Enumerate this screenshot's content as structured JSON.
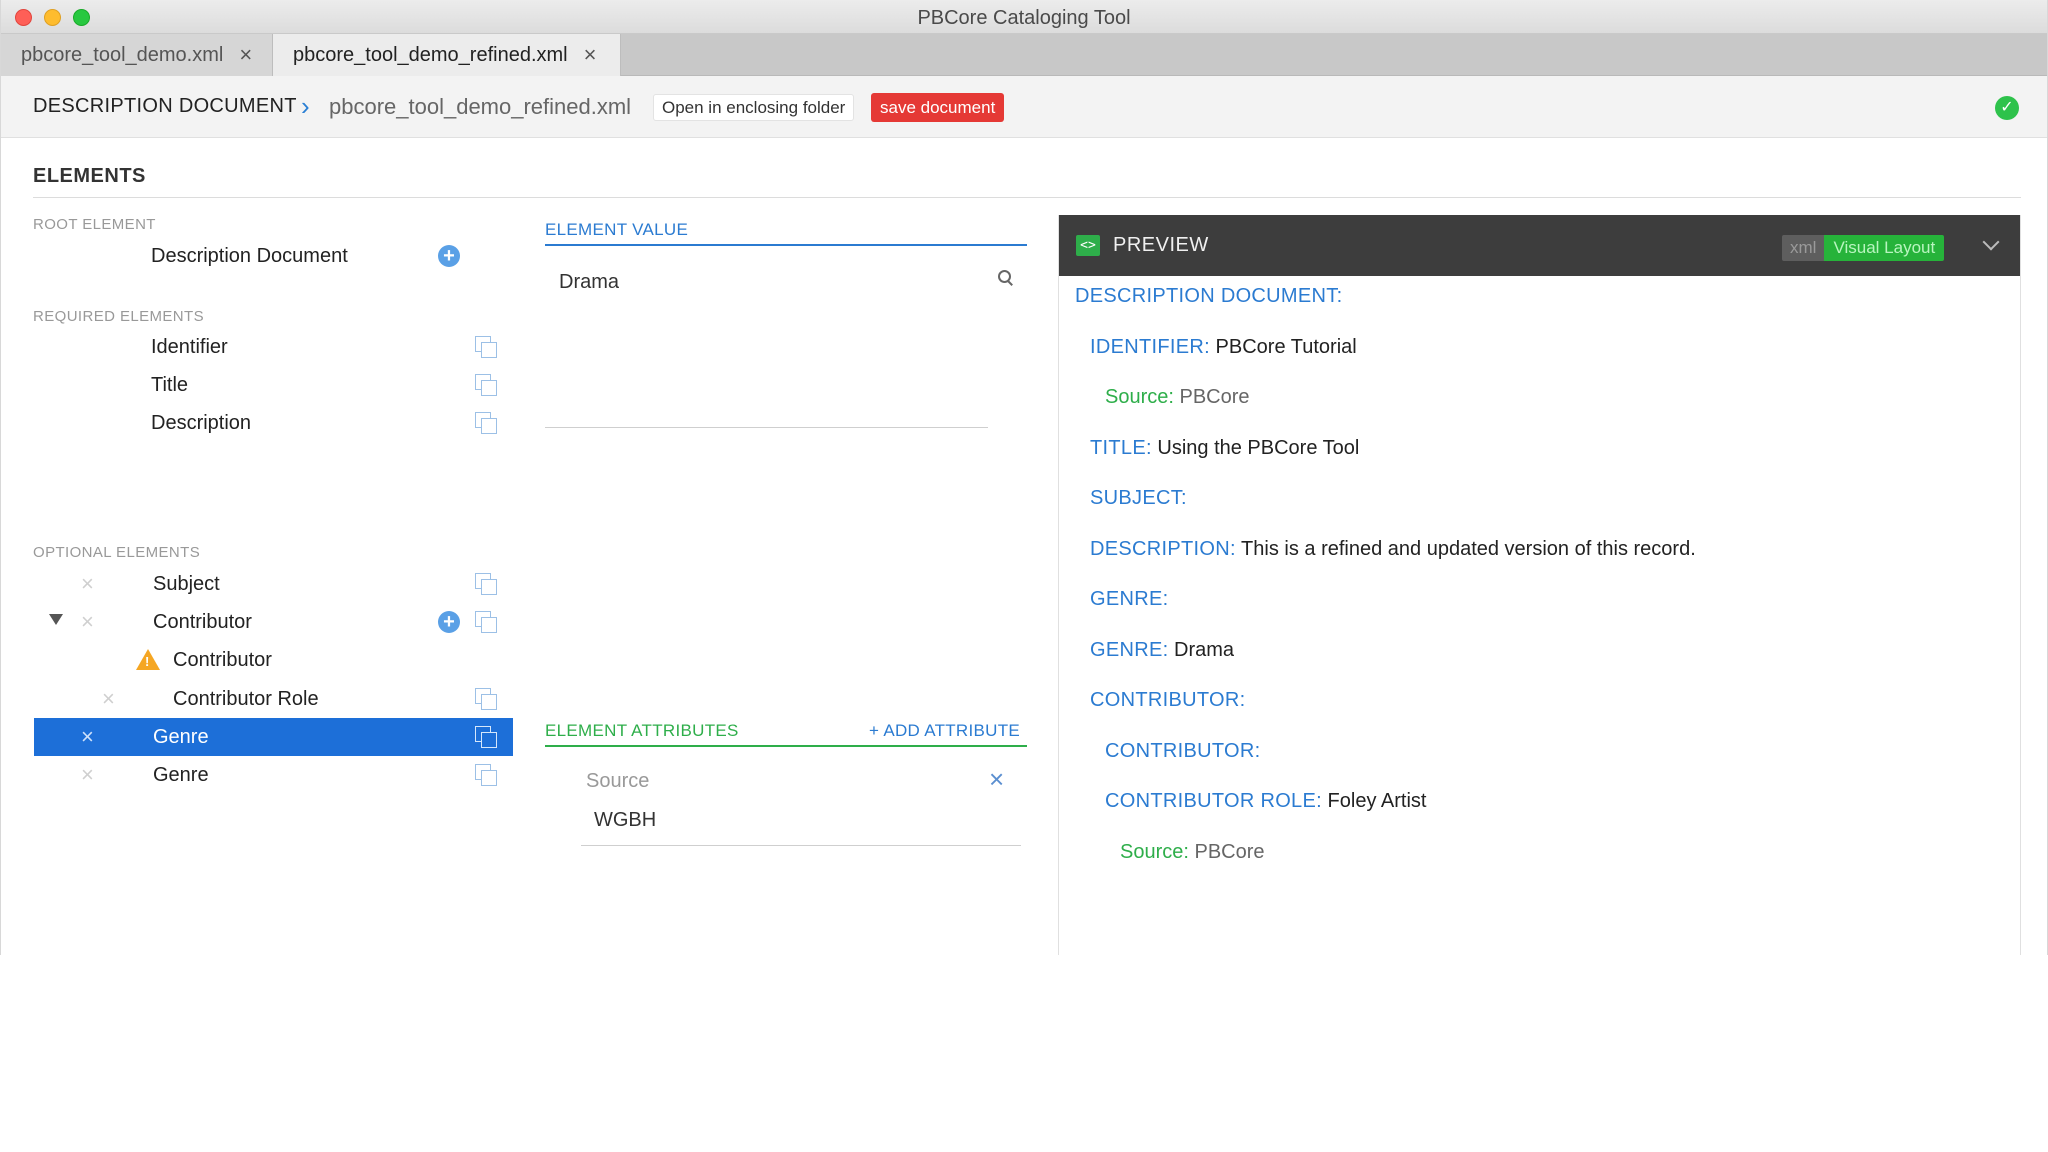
{
  "window": {
    "title": "PBCore Cataloging Tool"
  },
  "tabs": [
    {
      "label": "pbcore_tool_demo.xml",
      "close": "×"
    },
    {
      "label": "pbcore_tool_demo_refined.xml",
      "close": "×"
    }
  ],
  "breadcrumb": {
    "root": "DESCRIPTION DOCUMENT",
    "separator": "›",
    "file": "pbcore_tool_demo_refined.xml",
    "open_folder": "Open in enclosing folder",
    "save": "save document"
  },
  "elements": {
    "title": "ELEMENTS",
    "root_label": "ROOT ELEMENT",
    "root_item": "Description Document",
    "required_label": "REQUIRED ELEMENTS",
    "required": [
      "Identifier",
      "Title",
      "Description"
    ],
    "optional_label": "OPTIONAL ELEMENTS",
    "optional": [
      "Subject",
      "Contributor",
      "Contributor",
      "Contributor Role",
      "Genre",
      "Genre"
    ]
  },
  "element_value": {
    "label": "ELEMENT VALUE",
    "value": "Drama"
  },
  "attributes": {
    "label": "ELEMENT ATTRIBUTES",
    "add": "+ ADD ATTRIBUTE",
    "name": "Source",
    "value": "WGBH",
    "remove": "×"
  },
  "preview": {
    "title": "PREVIEW",
    "toggle_xml": "xml",
    "toggle_visual": "Visual Layout",
    "lines": [
      {
        "key": "DESCRIPTION DOCUMENT:",
        "value": ""
      },
      {
        "key": "IDENTIFIER:",
        "value": "PBCore Tutorial"
      },
      {
        "key": "Source:",
        "value": "PBCore"
      },
      {
        "key": "TITLE:",
        "value": "Using the PBCore Tool"
      },
      {
        "key": "SUBJECT:",
        "value": ""
      },
      {
        "key": "DESCRIPTION:",
        "value": "This is a refined and updated version of this record."
      },
      {
        "key": "GENRE:",
        "value": ""
      },
      {
        "key": "GENRE:",
        "value": "Drama"
      },
      {
        "key": "CONTRIBUTOR:",
        "value": ""
      },
      {
        "key": "CONTRIBUTOR:",
        "value": ""
      },
      {
        "key": "CONTRIBUTOR ROLE:",
        "value": "Foley Artist"
      },
      {
        "key": "Source:",
        "value": "PBCore"
      }
    ]
  },
  "colors": {
    "accent_blue": "#2b7bd1",
    "accent_green": "#2eae4a",
    "save_red": "#e53935",
    "selection_blue": "#1d6fd8"
  }
}
